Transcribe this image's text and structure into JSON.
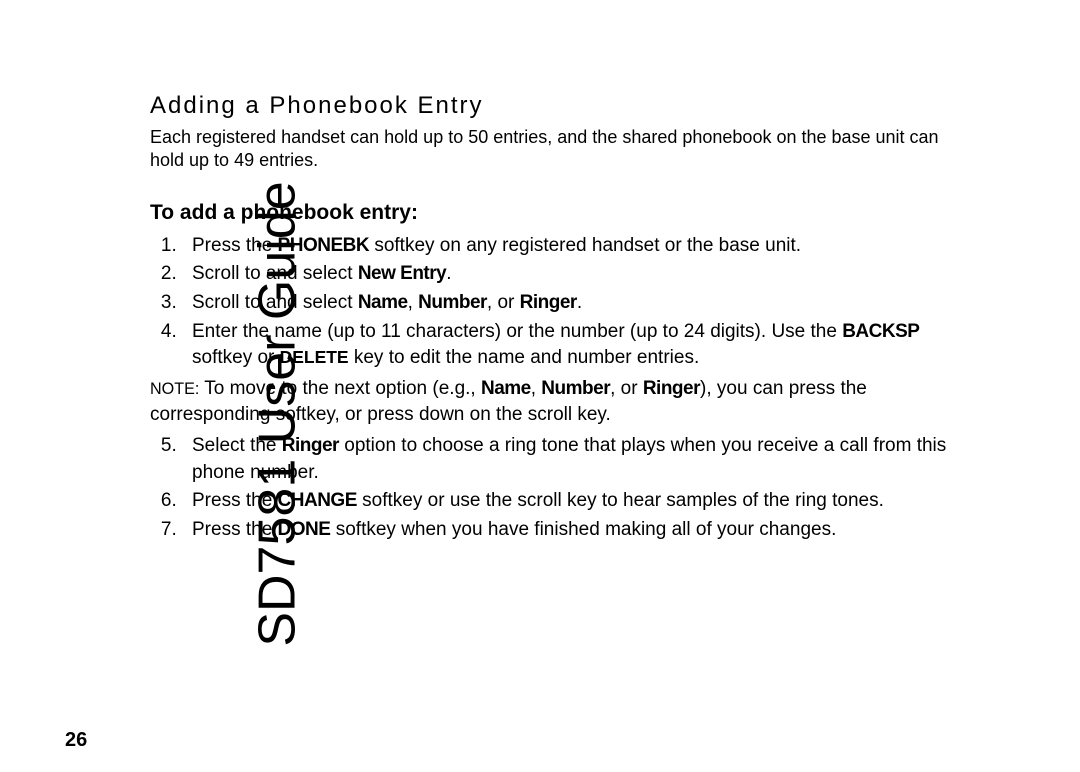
{
  "sidebar_title": "SD7581 User Guide",
  "page_number": "26",
  "section_heading": "Adding a Phonebook Entry",
  "intro_text": "Each registered handset can hold up to 50 entries, and the shared phonebook on the base unit can hold up to 49 entries.",
  "sub_heading": "To add a phonebook entry:",
  "steps": {
    "s1_a": "Press the ",
    "s1_key": "PHONEBK",
    "s1_b": " softkey on any registered handset or the base unit.",
    "s2_a": "Scroll to and select ",
    "s2_key": "New Entry",
    "s2_b": ".",
    "s3_a": "Scroll to and select ",
    "s3_k1": "Name",
    "s3_b": ", ",
    "s3_k2": "Number",
    "s3_c": ", or ",
    "s3_k3": "Ringer",
    "s3_d": ".",
    "s4_a": "Enter the name (up to 11 characters) or the number (up to 24 digits). Use the ",
    "s4_k1": "BACKSP",
    "s4_b": " softkey or ",
    "s4_k2": "DELETE",
    "s4_c": " key to edit the name and number entries.",
    "s5_a": "Select the ",
    "s5_k1": "Ringer",
    "s5_b": " option to choose a ring tone that plays when you receive a call from this phone number.",
    "s6_a": "Press the ",
    "s6_k1": "CHANGE",
    "s6_b": " softkey or use the scroll key to hear samples of the ring tones.",
    "s7_a": "Press the ",
    "s7_k1": "DONE",
    "s7_b": " softkey when you have finished making all of your changes."
  },
  "note": {
    "label": "NOTE:",
    "a": "  To move to the next option (e.g., ",
    "k1": "Name",
    "b": ", ",
    "k2": "Number",
    "c": ", or ",
    "k3": "Ringer",
    "d": "), you can press the corresponding softkey, or press down on the scroll key."
  }
}
